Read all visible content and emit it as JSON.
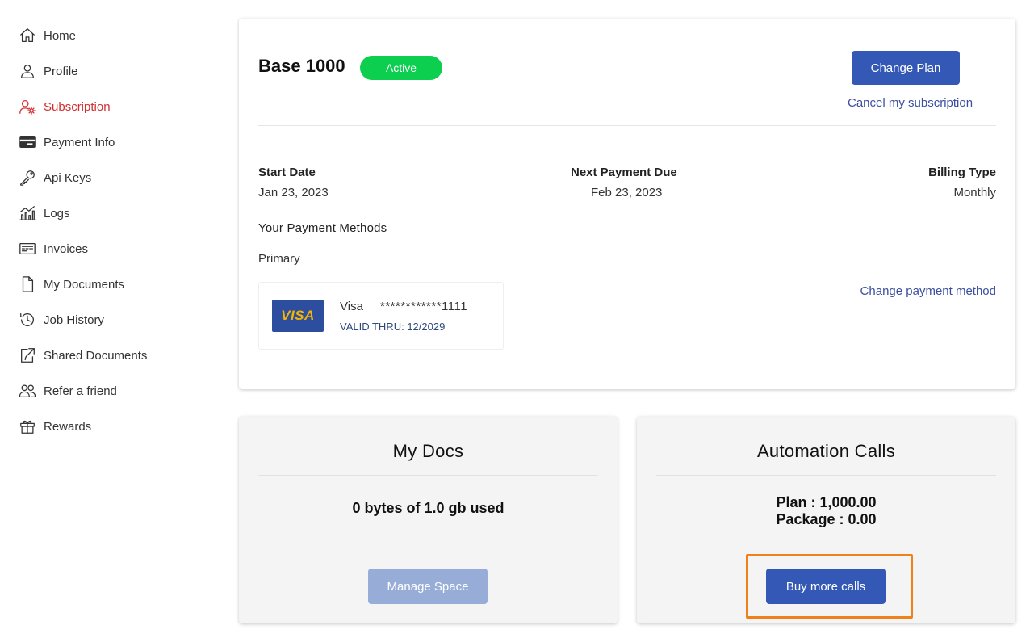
{
  "sidebar": {
    "items": [
      {
        "label": "Home",
        "icon": "home-icon"
      },
      {
        "label": "Profile",
        "icon": "user-icon"
      },
      {
        "label": "Subscription",
        "icon": "user-gear-icon",
        "active": true
      },
      {
        "label": "Payment Info",
        "icon": "credit-card-icon"
      },
      {
        "label": "Api Keys",
        "icon": "key-icon"
      },
      {
        "label": "Logs",
        "icon": "chart-icon"
      },
      {
        "label": "Invoices",
        "icon": "invoice-icon"
      },
      {
        "label": "My Documents",
        "icon": "document-icon"
      },
      {
        "label": "Job History",
        "icon": "history-icon"
      },
      {
        "label": "Shared Documents",
        "icon": "share-icon"
      },
      {
        "label": "Refer a friend",
        "icon": "users-icon"
      },
      {
        "label": "Rewards",
        "icon": "gift-icon"
      }
    ]
  },
  "plan": {
    "name": "Base 1000",
    "status": "Active",
    "change_plan_label": "Change Plan",
    "cancel_label": "Cancel my subscription"
  },
  "billing": {
    "start_date_label": "Start Date",
    "start_date": "Jan 23, 2023",
    "next_payment_label": "Next Payment Due",
    "next_payment": "Feb 23, 2023",
    "billing_type_label": "Billing Type",
    "billing_type": "Monthly"
  },
  "payment_methods": {
    "title": "Your Payment Methods",
    "primary_label": "Primary",
    "change_label": "Change payment method",
    "card": {
      "logo_text": "VISA",
      "brand": "Visa",
      "number": "************1111",
      "valid_thru": "VALID THRU: 12/2029"
    }
  },
  "docs": {
    "title": "My Docs",
    "usage": "0 bytes of 1.0 gb used",
    "button_label": "Manage Space"
  },
  "calls": {
    "title": "Automation Calls",
    "plan": "Plan : 1,000.00",
    "package": "Package : 0.00",
    "button_label": "Buy more calls"
  },
  "colors": {
    "primary": "#3458b5",
    "active_badge": "#0ccf50",
    "active_nav": "#d32f2f",
    "highlight": "#f0801a"
  }
}
